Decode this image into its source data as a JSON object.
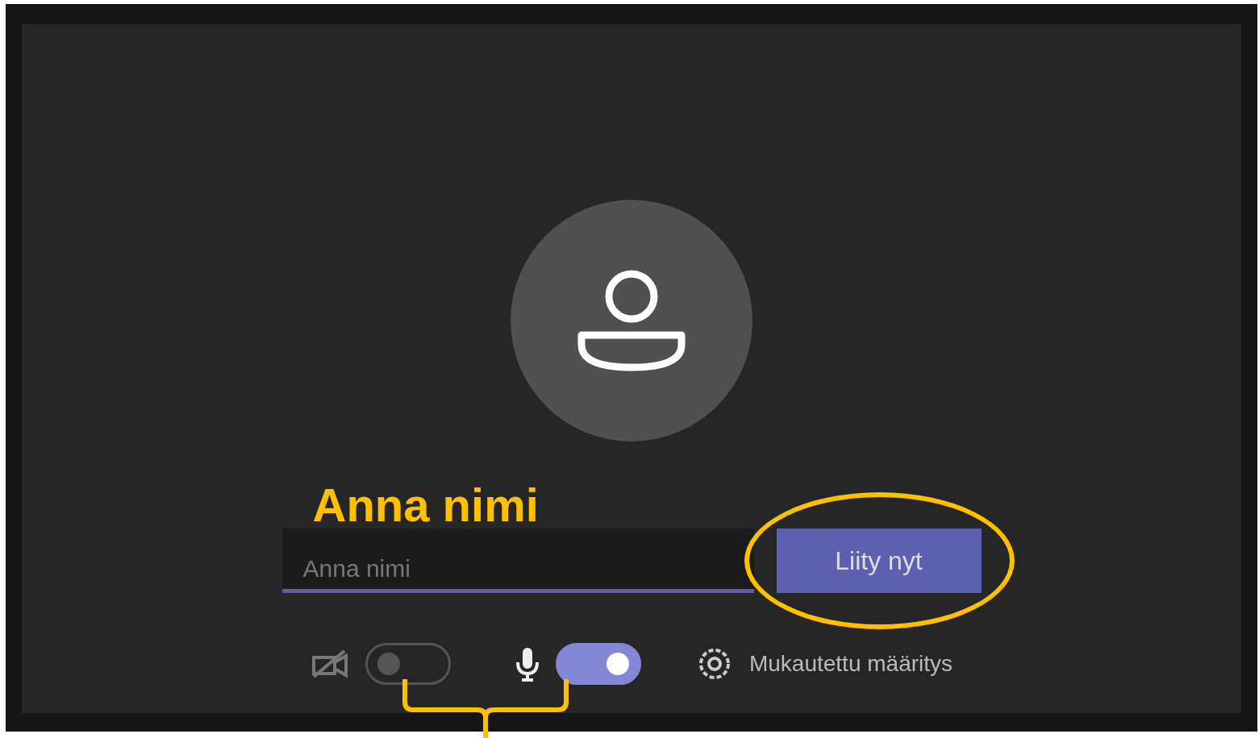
{
  "annotation": {
    "label": "Anna nimi"
  },
  "name_field": {
    "placeholder": "Anna nimi"
  },
  "join_button": {
    "label": "Liity nyt"
  },
  "camera": {
    "on": false
  },
  "microphone": {
    "on": true
  },
  "settings": {
    "label": "Mukautettu määritys"
  }
}
